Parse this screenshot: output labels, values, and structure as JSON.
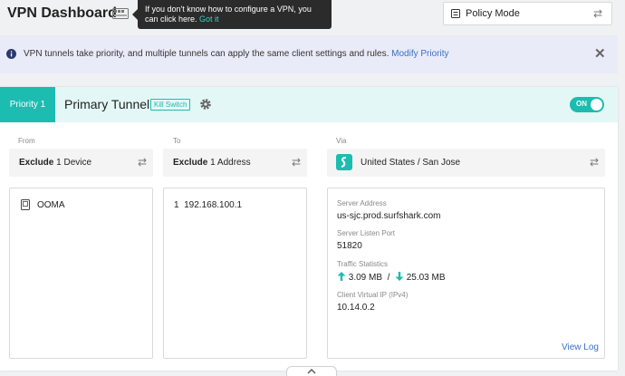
{
  "header": {
    "title": "VPN Dashboard",
    "tooltip_text": "If you don't know how to configure a VPN, you can click here.",
    "tooltip_link": "Got it",
    "policy_label": "Policy Mode"
  },
  "banner": {
    "text": "VPN tunnels take priority, and multiple tunnels can apply the same client settings and rules.",
    "link": "Modify Priority"
  },
  "tunnel": {
    "priority": "Priority 1",
    "name": "Primary Tunnel",
    "kill_switch": "Kill Switch",
    "toggle": "ON",
    "from": {
      "label": "From",
      "mode": "Exclude",
      "count_text": "1 Device",
      "devices": [
        {
          "name": "OOMA"
        }
      ]
    },
    "to": {
      "label": "To",
      "mode": "Exclude",
      "count_text": "1 Address",
      "addresses": [
        {
          "index": "1",
          "address": "192.168.100.1"
        }
      ]
    },
    "via": {
      "label": "Via",
      "location": "United States / San Jose",
      "server_address_label": "Server Address",
      "server_address": "us-sjc.prod.surfshark.com",
      "listen_port_label": "Server Listen Port",
      "listen_port": "51820",
      "traffic_label": "Traffic Statistics",
      "upload": "3.09 MB",
      "separator": "/",
      "download": "25.03 MB",
      "client_ip_label": "Client Virtual IP (IPv4)",
      "client_ip": "10.14.0.2",
      "view_log": "View Log"
    }
  },
  "colors": {
    "accent": "#1cbcb0",
    "link": "#3a6fc9"
  }
}
